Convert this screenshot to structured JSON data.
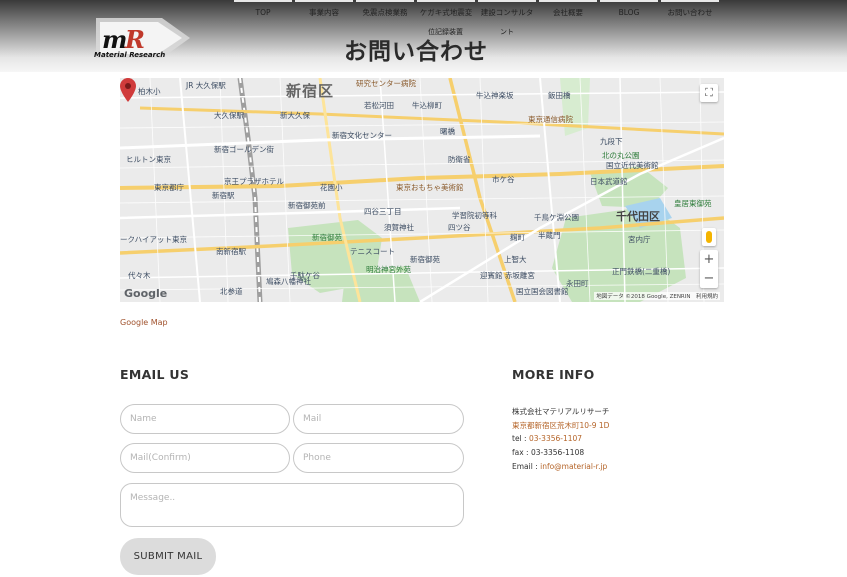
{
  "header": {
    "logo_text": "Material Research",
    "page_title": "お問い合わせ",
    "nav": [
      {
        "label": "TOP"
      },
      {
        "label": "事業内容"
      },
      {
        "label": "免震点検業務"
      },
      {
        "label": "ケガキ式地震変"
      },
      {
        "label": "建設コンサルタ"
      },
      {
        "label": "会社概要"
      },
      {
        "label": "BLOG"
      },
      {
        "label": "お問い合わせ"
      }
    ],
    "nav_overflow_1": "位記録装置",
    "nav_overflow_2": "ント"
  },
  "map": {
    "labels": {
      "shinjuku_ku": "新宿区",
      "chiyoda_ku": "千代田区",
      "kashiwagi": "柏木小",
      "okubo": "JR 大久保駅",
      "okubo_st": "大久保駅",
      "shin_okubo": "新大久保",
      "hilton": "ヒルトン東京",
      "golden_gai": "新宿ゴールデン街",
      "keio_plaza": "京王プラザホテル",
      "tocho": "東京都庁",
      "shinjuku_station": "新宿駅",
      "hyatt": "ークハイアット東京",
      "minami_shinjuku": "南新宿駅",
      "yoyogi": "代々木",
      "gyoen": "新宿御苑前",
      "shinjuku_gyoen": "新宿御苑",
      "sendagaya": "千駄ケ谷",
      "meiji_jingu": "明治神宮外苑",
      "kokuritsu": "国立競技場",
      "hanazono": "花園小",
      "yotsuya_3": "四谷三丁目",
      "yotsuya": "四ツ谷",
      "sugawara": "須賀神社",
      "gakushuin": "学習院初等科",
      "akasaka": "迎賓館 赤坂離宮",
      "ichigaya": "市ケ谷",
      "bouei": "防衛省",
      "omocha": "東京おもちゃ美術館",
      "bunka": "新宿文化センター",
      "kenkyu": "研究センター病院",
      "ushigome": "牛込柳町",
      "ushigome_kagurazaka": "牛込神楽坂",
      "iidabashi": "飯田橋",
      "kudanshita": "九段下",
      "budokan": "日本武道館",
      "chidorigafuchi": "千鳥ケ淵公園",
      "hanzomon": "半蔵門",
      "kojimachi": "麹町",
      "kokkai": "国立国会図書館",
      "imperial_east": "皇居東御苑",
      "kyuden": "宮内庁",
      "sakuradamon": "正門鉄橋(二重橋)",
      "kitanomaru": "北の丸公園",
      "kinkyo": "国立近代美術館",
      "nagatacho": "永田町",
      "aoyama": "青山",
      "kitasando": "北参道",
      "jinja": "鳩森八幡神社",
      "akebonobashi": "曙橋",
      "wakamatsu": "若松河田",
      "edogawabashi": "東京通信病院",
      "koishikawa": "小石川",
      "jidai": "上智大",
      "kinshi": "新宿御苑",
      "tennis": "テニスコート"
    },
    "google_logo": "Google",
    "attribution": "地図データ ©2018 Google, ZENRIN　利用規約",
    "fullscreen": "⛶",
    "zoom_in": "+",
    "zoom_out": "−"
  },
  "map_link": "Google Map",
  "email_us": {
    "title": "EMAIL US",
    "name_placeholder": "Name",
    "mail_placeholder": "Mail",
    "mail_confirm_placeholder": "Mail(Confirm)",
    "phone_placeholder": "Phone",
    "message_placeholder": "Message..",
    "submit_label": "SUBMIT MAIL"
  },
  "more_info": {
    "title": "MORE INFO",
    "company": "株式会社マテリアルリサーチ",
    "address": "東京都新宿区荒木町10-9 1D",
    "tel_label": "tel : ",
    "tel": "03-3356-1107",
    "fax_label": "fax : ",
    "fax": "03-3356-1108",
    "email_label": "Email : ",
    "email": "info@material-r.jp"
  },
  "colors": {
    "link": "#b5652a",
    "map_green": "#c8e6c0",
    "map_water": "#a6d2f0",
    "pin": "#d03b3b"
  }
}
